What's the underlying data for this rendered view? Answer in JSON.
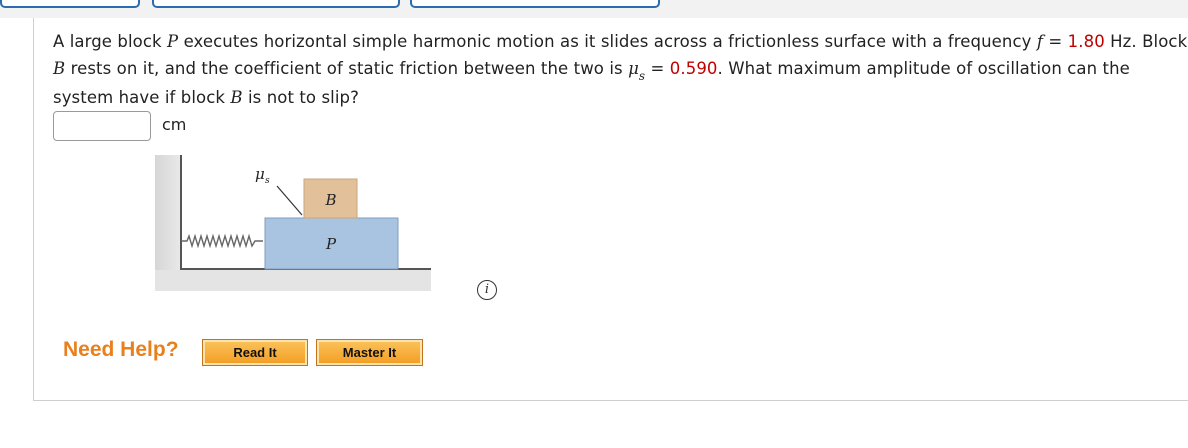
{
  "question": {
    "intro": "A large block ",
    "p_symbol": "P",
    "part2": " executes horizontal simple harmonic motion as it slides across a frictionless surface with a frequency ",
    "f_symbol": "f",
    "part3": " = ",
    "f_value": "1.80",
    "part4": " Hz. Block ",
    "b_symbol": "B",
    "part5": " rests on it, and the coefficient of static friction between the two is ",
    "mu_symbol": "μ",
    "mu_sub": "s",
    "part6": " = ",
    "mu_value": "0.590",
    "part7": ". What maximum amplitude of oscillation can the system have if block ",
    "b_symbol2": "B",
    "part8": " is not to slip?"
  },
  "answer": {
    "value": "",
    "unit": "cm"
  },
  "figure": {
    "block_top": "B",
    "block_bottom": "P",
    "mu_label": "μ",
    "mu_label_sub": "s"
  },
  "info_icon": "i",
  "help": {
    "label": "Need Help?",
    "read_it": "Read It",
    "master_it": "Master It"
  },
  "colors": {
    "given_value": "#c00000",
    "help_text": "#e8801e",
    "button_fill": "#f39c21",
    "block_b": "#e2c19a",
    "block_p": "#a8c4e0"
  }
}
